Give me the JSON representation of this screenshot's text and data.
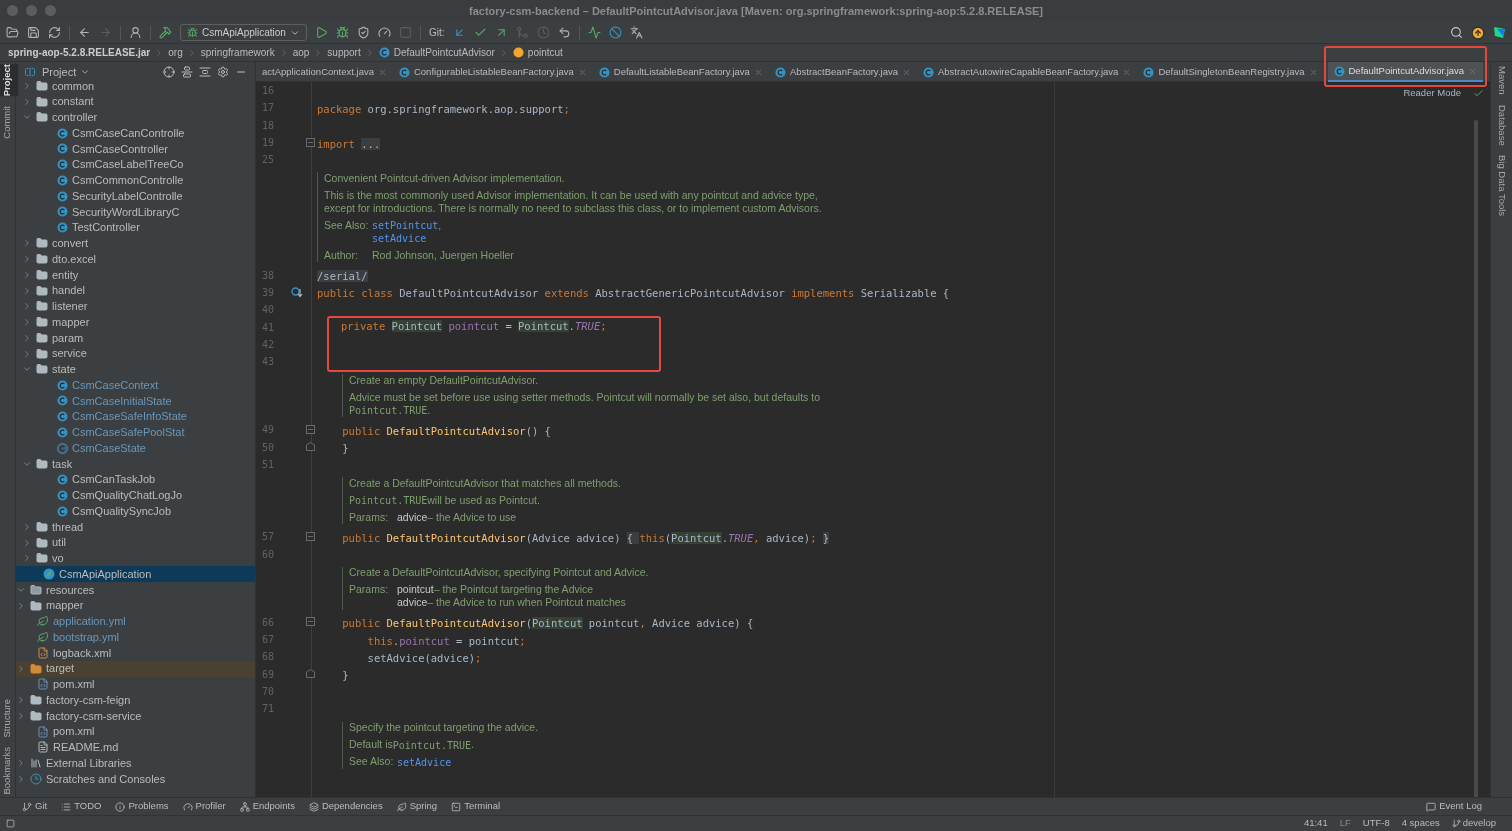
{
  "window": {
    "title": "factory-csm-backend – DefaultPointcutAdvisor.java [Maven: org.springframework:spring-aop:5.2.8.RELEASE]"
  },
  "toolbar": {
    "run_config": "CsmApiApplication",
    "git_label": "Git:",
    "buttons": [
      {
        "kind": "open",
        "disabled": false
      },
      {
        "kind": "save",
        "disabled": false
      },
      {
        "kind": "sync",
        "disabled": false
      },
      {
        "kind": "sep"
      },
      {
        "kind": "back",
        "disabled": false
      },
      {
        "kind": "forward",
        "disabled": true
      },
      {
        "kind": "sep"
      },
      {
        "kind": "user",
        "disabled": false
      },
      {
        "kind": "sep"
      },
      {
        "kind": "build",
        "disabled": false
      },
      {
        "kind": "config"
      },
      {
        "kind": "run",
        "disabled": false
      },
      {
        "kind": "debug",
        "disabled": false
      },
      {
        "kind": "coverage",
        "disabled": false
      },
      {
        "kind": "profile",
        "disabled": false
      },
      {
        "kind": "stop",
        "disabled": true
      },
      {
        "kind": "sep"
      },
      {
        "kind": "git"
      },
      {
        "kind": "update",
        "disabled": false
      },
      {
        "kind": "commit",
        "disabled": false
      },
      {
        "kind": "push",
        "disabled": false
      },
      {
        "kind": "merge",
        "disabled": true
      },
      {
        "kind": "history",
        "disabled": true
      },
      {
        "kind": "rollback",
        "disabled": false
      },
      {
        "kind": "sep"
      },
      {
        "kind": "chart",
        "disabled": false
      },
      {
        "kind": "block",
        "disabled": false
      },
      {
        "kind": "translate",
        "disabled": false
      }
    ]
  },
  "breadcrumb": [
    {
      "label": "spring-aop-5.2.8.RELEASE.jar",
      "kind": "plain"
    },
    {
      "label": "org",
      "kind": "plain"
    },
    {
      "label": "springframework",
      "kind": "plain"
    },
    {
      "label": "aop",
      "kind": "plain"
    },
    {
      "label": "support",
      "kind": "plain"
    },
    {
      "label": "DefaultPointcutAdvisor",
      "kind": "class"
    },
    {
      "label": "pointcut",
      "kind": "field"
    }
  ],
  "left_tools_top": [
    {
      "label": "Project",
      "selected": true
    },
    {
      "label": "Commit",
      "selected": false
    }
  ],
  "left_tools_bottom": [
    {
      "label": "Structure",
      "selected": false
    },
    {
      "label": "Bookmarks",
      "selected": false
    }
  ],
  "right_tools": [
    {
      "label": "Maven"
    },
    {
      "label": "Database"
    },
    {
      "label": "Big Data Tools"
    }
  ],
  "project": {
    "title": "Project",
    "tree": [
      {
        "children": [
          {
            "children": [
              {
                "children": [
                  {
                    "children": [
                      {
                        "children": [
                          {
                            "children": [
                              {
                                "label": "common",
                                "kind": "folder",
                                "expanded": false,
                                "selected": false,
                                "modified": false
                              },
                              {
                                "label": "constant",
                                "kind": "folder",
                                "expanded": false,
                                "selected": false,
                                "modified": false
                              },
                              {
                                "label": "controller",
                                "kind": "folder",
                                "expanded": true,
                                "selected": false,
                                "modified": false,
                                "children": [
                                  {
                                    "label": "CsmCaseCanControlle",
                                    "kind": "class",
                                    "selected": false,
                                    "modified": false
                                  },
                                  {
                                    "label": "CsmCaseController",
                                    "kind": "class",
                                    "selected": false,
                                    "modified": false
                                  },
                                  {
                                    "label": "CsmCaseLabelTreeCo",
                                    "kind": "class",
                                    "selected": false,
                                    "modified": false
                                  },
                                  {
                                    "label": "CsmCommonControlle",
                                    "kind": "class",
                                    "selected": false,
                                    "modified": false
                                  },
                                  {
                                    "label": "SecurityLabelControlle",
                                    "kind": "class",
                                    "selected": false,
                                    "modified": false
                                  },
                                  {
                                    "label": "SecurityWordLibraryC",
                                    "kind": "class",
                                    "selected": false,
                                    "modified": false
                                  },
                                  {
                                    "label": "TestController",
                                    "kind": "class",
                                    "selected": false,
                                    "modified": false
                                  }
                                ]
                              },
                              {
                                "label": "convert",
                                "kind": "folder",
                                "expanded": false,
                                "selected": false,
                                "modified": false
                              },
                              {
                                "label": "dto.excel",
                                "kind": "folder",
                                "expanded": false,
                                "selected": false,
                                "modified": false
                              },
                              {
                                "label": "entity",
                                "kind": "folder",
                                "expanded": false,
                                "selected": false,
                                "modified": false
                              },
                              {
                                "label": "handel",
                                "kind": "folder",
                                "expanded": false,
                                "selected": false,
                                "modified": false
                              },
                              {
                                "label": "listener",
                                "kind": "folder",
                                "expanded": false,
                                "selected": false,
                                "modified": false
                              },
                              {
                                "label": "mapper",
                                "kind": "folder",
                                "expanded": false,
                                "selected": false,
                                "modified": false
                              },
                              {
                                "label": "param",
                                "kind": "folder",
                                "expanded": false,
                                "selected": false,
                                "modified": false
                              },
                              {
                                "label": "service",
                                "kind": "folder",
                                "expanded": false,
                                "selected": false,
                                "modified": false
                              },
                              {
                                "label": "state",
                                "kind": "folder",
                                "expanded": true,
                                "selected": false,
                                "modified": false,
                                "children": [
                                  {
                                    "label": "CsmCaseContext",
                                    "kind": "class",
                                    "selected": false,
                                    "modified": true
                                  },
                                  {
                                    "label": "CsmCaseInitialState",
                                    "kind": "class",
                                    "selected": false,
                                    "modified": true
                                  },
                                  {
                                    "label": "CsmCaseSafeInfoState",
                                    "kind": "class",
                                    "selected": false,
                                    "modified": true
                                  },
                                  {
                                    "label": "CsmCaseSafePoolStat",
                                    "kind": "class",
                                    "selected": false,
                                    "modified": true
                                  },
                                  {
                                    "label": "CsmCaseState",
                                    "kind": "abstract",
                                    "selected": false,
                                    "modified": true
                                  }
                                ]
                              },
                              {
                                "label": "task",
                                "kind": "folder",
                                "expanded": true,
                                "selected": false,
                                "modified": false,
                                "children": [
                                  {
                                    "label": "CsmCanTaskJob",
                                    "kind": "class",
                                    "selected": false,
                                    "modified": false
                                  },
                                  {
                                    "label": "CsmQualityChatLogJo",
                                    "kind": "class",
                                    "selected": false,
                                    "modified": false
                                  },
                                  {
                                    "label": "CsmQualitySyncJob",
                                    "kind": "class",
                                    "selected": false,
                                    "modified": false
                                  }
                                ]
                              },
                              {
                                "label": "thread",
                                "kind": "folder",
                                "expanded": false,
                                "selected": false,
                                "modified": false
                              },
                              {
                                "label": "util",
                                "kind": "folder",
                                "expanded": false,
                                "selected": false,
                                "modified": false
                              },
                              {
                                "label": "vo",
                                "kind": "folder",
                                "expanded": false,
                                "selected": false,
                                "modified": false
                              },
                              {
                                "label": "CsmApiApplication",
                                "kind": "app",
                                "selected": true,
                                "modified": false
                              }
                            ]
                          }
                        ]
                      },
                      {
                        "label": "resources",
                        "kind": "resources",
                        "expanded": true,
                        "selected": false,
                        "modified": false,
                        "children": [
                          {
                            "label": "mapper",
                            "kind": "folder",
                            "expanded": false,
                            "selected": false,
                            "modified": false
                          },
                          {
                            "label": "application.yml",
                            "kind": "yml",
                            "selected": false,
                            "modified": true
                          },
                          {
                            "label": "bootstrap.yml",
                            "kind": "yml",
                            "selected": false,
                            "modified": true
                          },
                          {
                            "label": "logback.xml",
                            "kind": "xml",
                            "selected": false,
                            "modified": false
                          }
                        ]
                      }
                    ]
                  }
                ]
              },
              {
                "label": "target",
                "kind": "excluded",
                "expanded": false,
                "selected": false,
                "modified": false
              },
              {
                "label": "pom.xml",
                "kind": "maven",
                "selected": false,
                "modified": false
              }
            ]
          },
          {
            "label": "factory-csm-feign",
            "kind": "module",
            "expanded": false,
            "selected": false,
            "modified": false
          },
          {
            "label": "factory-csm-service",
            "kind": "module",
            "expanded": false,
            "selected": false,
            "modified": false
          },
          {
            "label": "pom.xml",
            "kind": "maven",
            "selected": false,
            "modified": false
          },
          {
            "label": "README.md",
            "kind": "md",
            "selected": false,
            "modified": false
          }
        ]
      },
      {
        "label": "External Libraries",
        "kind": "libraries",
        "expanded": false,
        "selected": false,
        "modified": false
      },
      {
        "label": "Scratches and Consoles",
        "kind": "scratches",
        "expanded": false,
        "selected": false,
        "modified": false
      }
    ]
  },
  "tabs": [
    {
      "label": "actApplicationContext.java",
      "selected": false,
      "annotated": false
    },
    {
      "label": "ConfigurableListableBeanFactory.java",
      "selected": false,
      "annotated": false
    },
    {
      "label": "DefaultListableBeanFactory.java",
      "selected": false,
      "annotated": false
    },
    {
      "label": "AbstractBeanFactory.java",
      "selected": false,
      "annotated": false
    },
    {
      "label": "AbstractAutowireCapableBeanFactory.java",
      "selected": false,
      "annotated": false
    },
    {
      "label": "DefaultSingletonBeanRegistry.java",
      "selected": false,
      "annotated": false
    },
    {
      "label": "DefaultPointcutAdvisor.java",
      "selected": true,
      "annotated": true
    }
  ],
  "editor": {
    "reader_mode": "Reader Mode",
    "blocks": [
      {
        "kind": "code",
        "number": "16"
      },
      {
        "kind": "code",
        "number": "17",
        "tokens": [
          {
            "t": "package",
            "kind": "kw"
          },
          {
            "t": " org.springframework.aop.support",
            "kind": "plain"
          },
          {
            "t": ";",
            "kind": "kw"
          }
        ]
      },
      {
        "kind": "code",
        "number": "18"
      },
      {
        "kind": "code",
        "number": "19",
        "gutter": {
          "kind": "fold"
        },
        "tokens": [
          {
            "t": "import ",
            "kind": "kw"
          },
          {
            "t": "...",
            "kind": "fold"
          }
        ]
      },
      {
        "kind": "code",
        "number": "25"
      },
      {
        "kind": "doc",
        "paragraphs": [
          {
            "lines": [
              [
                {
                  "t": "Convenient Pointcut-driven Advisor implementation.",
                  "kind": "text"
                }
              ]
            ]
          },
          {
            "lines": [
              [
                {
                  "t": "This is the most commonly used Advisor implementation. It can be used with any pointcut and advice type,",
                  "kind": "text"
                }
              ],
              [
                {
                  "t": "except for introductions. There is normally no need to subclass this class, or to implement custom Advisors.",
                  "kind": "text"
                }
              ]
            ]
          },
          {
            "label": "See Also:",
            "lines": [
              [
                {
                  "t": "setPointcut",
                  "kind": "link"
                },
                {
                  "t": ",",
                  "kind": "text"
                }
              ],
              [
                {
                  "t": "setAdvice",
                  "kind": "link"
                }
              ]
            ]
          },
          {
            "label": "Author:",
            "lines": [
              [
                {
                  "t": "Rod Johnson, Juergen Hoeller",
                  "kind": "text"
                }
              ]
            ]
          }
        ]
      },
      {
        "kind": "code",
        "number": "38",
        "tokens": [
          {
            "t": "/serial/",
            "kind": "fold"
          }
        ]
      },
      {
        "kind": "code",
        "number": "39",
        "gutter": {
          "kind": "override"
        },
        "tokens": [
          {
            "t": "public class ",
            "kind": "kw"
          },
          {
            "t": "DefaultPointcutAdvisor ",
            "kind": "plain"
          },
          {
            "t": "extends ",
            "kind": "kw"
          },
          {
            "t": "AbstractGenericPointcutAdvisor ",
            "kind": "plain"
          },
          {
            "t": "implements ",
            "kind": "kw"
          },
          {
            "t": "Serializable {",
            "kind": "plain"
          }
        ]
      },
      {
        "kind": "code",
        "number": "40"
      },
      {
        "kind": "callout",
        "lines": [
          {
            "number": "41",
            "tokens": [
              {
                "t": "private ",
                "kind": "kw"
              },
              {
                "t": "Pointcut",
                "kind": "hl"
              },
              {
                "t": " pointcut",
                "kind": "field"
              },
              {
                "t": " = ",
                "kind": "plain"
              },
              {
                "t": "Pointcut",
                "kind": "hl"
              },
              {
                "t": ".",
                "kind": "plain"
              },
              {
                "t": "TRUE",
                "kind": "const"
              },
              {
                "t": ";",
                "kind": "kw"
              }
            ]
          },
          {
            "number": "42"
          },
          {
            "number": "43"
          }
        ]
      },
      {
        "kind": "member-doc",
        "paragraphs": [
          {
            "lines": [
              [
                {
                  "t": "Create an empty DefaultPointcutAdvisor.",
                  "kind": "text"
                }
              ]
            ]
          },
          {
            "lines": [
              [
                {
                  "t": "Advice must be set before use using setter methods. Pointcut will normally be set also, but defaults to",
                  "kind": "text"
                }
              ],
              [
                {
                  "t": "Pointcut.TRUE",
                  "kind": "code"
                },
                {
                  "t": ".",
                  "kind": "text"
                }
              ]
            ]
          }
        ]
      },
      {
        "kind": "code",
        "number": "49",
        "gutter": {
          "kind": "fold"
        },
        "tokens": [
          {
            "t": "    public ",
            "kind": "kw"
          },
          {
            "t": "DefaultPointcutAdvisor",
            "kind": "fn"
          },
          {
            "t": "() {",
            "kind": "plain"
          }
        ]
      },
      {
        "kind": "code",
        "number": "50",
        "gutter": {
          "kind": "fold-end"
        },
        "tokens": [
          {
            "t": "    }",
            "kind": "plain"
          }
        ]
      },
      {
        "kind": "code",
        "number": "51"
      },
      {
        "kind": "member-doc",
        "paragraphs": [
          {
            "lines": [
              [
                {
                  "t": "Create a DefaultPointcutAdvisor that matches all methods.",
                  "kind": "text"
                }
              ]
            ]
          },
          {
            "lines": [
              [
                {
                  "t": "Pointcut.TRUE",
                  "kind": "code"
                },
                {
                  "t": " will be used as Pointcut.",
                  "kind": "text"
                }
              ]
            ]
          },
          {
            "label": "Params:",
            "lines": [
              [
                {
                  "t": "advice",
                  "kind": "name"
                },
                {
                  "t": " – the Advice to use",
                  "kind": "text"
                }
              ]
            ]
          }
        ]
      },
      {
        "kind": "code",
        "number": "57",
        "gutter": {
          "kind": "fold"
        },
        "tokens": [
          {
            "t": "    public ",
            "kind": "kw"
          },
          {
            "t": "DefaultPointcutAdvisor",
            "kind": "fn"
          },
          {
            "t": "(Advice advice) ",
            "kind": "plain"
          },
          {
            "t": "{ ",
            "kind": "fold"
          },
          {
            "t": "this",
            "kind": "kw"
          },
          {
            "t": "(",
            "kind": "plain"
          },
          {
            "t": "Pointcut",
            "kind": "hl"
          },
          {
            "t": ".",
            "kind": "plain"
          },
          {
            "t": "TRUE",
            "kind": "const"
          },
          {
            "t": ", ",
            "kind": "kw"
          },
          {
            "t": "advice)",
            "kind": "plain"
          },
          {
            "t": "; ",
            "kind": "kw"
          },
          {
            "t": "}",
            "kind": "fold"
          }
        ]
      },
      {
        "kind": "code",
        "number": "60"
      },
      {
        "kind": "member-doc",
        "paragraphs": [
          {
            "lines": [
              [
                {
                  "t": "Create a DefaultPointcutAdvisor, specifying Pointcut and Advice.",
                  "kind": "text"
                }
              ]
            ]
          },
          {
            "label": "Params:",
            "lines": [
              [
                {
                  "t": "pointcut",
                  "kind": "name"
                },
                {
                  "t": " – the Pointcut targeting the Advice",
                  "kind": "text"
                }
              ],
              [
                {
                  "t": "advice",
                  "kind": "name"
                },
                {
                  "t": " – the Advice to run when Pointcut matches",
                  "kind": "text"
                }
              ]
            ]
          }
        ]
      },
      {
        "kind": "code",
        "number": "66",
        "gutter": {
          "kind": "fold"
        },
        "tokens": [
          {
            "t": "    public ",
            "kind": "kw"
          },
          {
            "t": "DefaultPointcutAdvisor",
            "kind": "fn"
          },
          {
            "t": "(",
            "kind": "plain"
          },
          {
            "t": "Pointcut",
            "kind": "hl"
          },
          {
            "t": " pointcut",
            "kind": "plain"
          },
          {
            "t": ",",
            "kind": "kw"
          },
          {
            "t": " Advice advice) {",
            "kind": "plain"
          }
        ]
      },
      {
        "kind": "code",
        "number": "67",
        "tokens": [
          {
            "t": "        this",
            "kind": "kw"
          },
          {
            "t": ".",
            "kind": "plain"
          },
          {
            "t": "pointcut",
            "kind": "field"
          },
          {
            "t": " = pointcut",
            "kind": "plain"
          },
          {
            "t": ";",
            "kind": "kw"
          }
        ]
      },
      {
        "kind": "code",
        "number": "68",
        "tokens": [
          {
            "t": "        setAdvice(advice)",
            "kind": "plain"
          },
          {
            "t": ";",
            "kind": "kw"
          }
        ]
      },
      {
        "kind": "code",
        "number": "69",
        "gutter": {
          "kind": "fold-end"
        },
        "tokens": [
          {
            "t": "    }",
            "kind": "plain"
          }
        ]
      },
      {
        "kind": "code",
        "number": "70"
      },
      {
        "kind": "code",
        "number": "71"
      },
      {
        "kind": "member-doc",
        "paragraphs": [
          {
            "lines": [
              [
                {
                  "t": "Specify the pointcut targeting the advice.",
                  "kind": "text"
                }
              ]
            ]
          },
          {
            "lines": [
              [
                {
                  "t": "Default is ",
                  "kind": "text"
                },
                {
                  "t": "Pointcut.TRUE",
                  "kind": "code"
                },
                {
                  "t": ".",
                  "kind": "text"
                }
              ]
            ]
          },
          {
            "label": "See Also:",
            "lines": [
              [
                {
                  "t": "setAdvice",
                  "kind": "link"
                }
              ]
            ]
          }
        ]
      }
    ]
  },
  "tool_windows": [
    {
      "label": "Git",
      "kind": "git"
    },
    {
      "label": "TODO",
      "kind": "list"
    },
    {
      "label": "Problems",
      "kind": "info"
    },
    {
      "label": "Profiler",
      "kind": "gauge"
    },
    {
      "label": "Endpoints",
      "kind": "nodes"
    },
    {
      "label": "Dependencies",
      "kind": "layers"
    },
    {
      "label": "Spring",
      "kind": "leaf"
    },
    {
      "label": "Terminal",
      "kind": "terminal"
    }
  ],
  "event_log": "Event Log",
  "status_bar": {
    "position": "41:41",
    "line_ending": "LF",
    "encoding": "UTF-8",
    "indent": "4 spaces",
    "branch": "develop"
  }
}
